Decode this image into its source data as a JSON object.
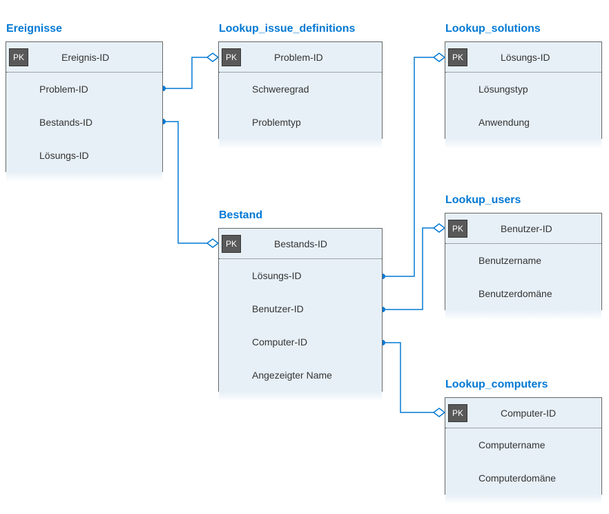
{
  "entities": {
    "ereignisse": {
      "title": "Ereignisse",
      "pk": "Ereignis-ID",
      "cols": [
        "Problem-ID",
        "Bestands-ID",
        "Lösungs-ID"
      ]
    },
    "issue": {
      "title": "Lookup_issue_definitions",
      "pk": "Problem-ID",
      "cols": [
        "Schweregrad",
        "Problemtyp"
      ]
    },
    "solutions": {
      "title": "Lookup_solutions",
      "pk": "Lösungs-ID",
      "cols": [
        "Lösungstyp",
        "Anwendung"
      ]
    },
    "bestand": {
      "title": "Bestand",
      "pk": "Bestands-ID",
      "cols": [
        "Lösungs-ID",
        "Benutzer-ID",
        "Computer-ID",
        "Angezeigter Name"
      ]
    },
    "users": {
      "title": "Lookup_users",
      "pk": "Benutzer-ID",
      "cols": [
        "Benutzername",
        "Benutzerdomäne"
      ]
    },
    "computers": {
      "title": "Lookup_computers",
      "pk": "Computer-ID",
      "cols": [
        "Computername",
        "Computerdomäne"
      ]
    }
  },
  "pk_label": "PK"
}
